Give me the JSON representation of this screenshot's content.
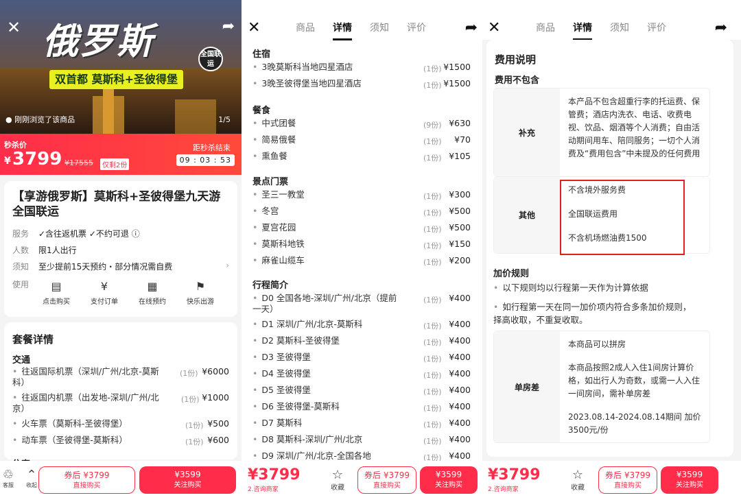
{
  "hero": {
    "title": "俄罗斯",
    "subtitle": "双首都 莫斯科+圣彼得堡",
    "badge": "全国联运",
    "viewed": "刚刚浏览了该商品",
    "count": "1/5"
  },
  "price": {
    "label": "秒杀价",
    "currency": "¥",
    "value": "3799",
    "original": "¥17555",
    "stock": "仅剩2份",
    "countdown_label": "距秒杀结束",
    "countdown": "09 : 03 : 53"
  },
  "product": {
    "title": "【享游俄罗斯】莫斯科+圣彼得堡九天游全国联运",
    "rows": [
      {
        "k": "服务",
        "v": "✓含往返机票  ✓不约可退 ⓘ"
      },
      {
        "k": "人数",
        "v": "限1人出行"
      },
      {
        "k": "须知",
        "v": "至少提前15天预约・部分情况需自费"
      },
      {
        "k": "使用",
        "v": ""
      }
    ],
    "steps": [
      "点击购买",
      "支付订单",
      "在线预约",
      "快乐出游"
    ]
  },
  "package": {
    "title": "套餐详情",
    "transport_title": "交通",
    "transport": [
      {
        "name": "往返国际机票（深圳/广州/北京-莫斯科）",
        "qty": "(1份)",
        "price": "¥6000"
      },
      {
        "name": "往返国内机票（出发地-深圳/广州/北京）",
        "qty": "(1份)",
        "price": "¥1000"
      },
      {
        "name": "火车票（莫斯科-圣彼得堡）",
        "qty": "(1份)",
        "price": "¥500"
      },
      {
        "name": "动车票（圣彼得堡-莫斯科）",
        "qty": "(1份)",
        "price": "¥600"
      }
    ],
    "next_title": "住宿"
  },
  "detail": {
    "tabs": [
      "商品",
      "详情",
      "须知",
      "评价"
    ],
    "lodging_title": "住宿",
    "lodging": [
      {
        "name": "3晚莫斯科当地四星酒店",
        "qty": "(1份)",
        "price": "¥1500"
      },
      {
        "name": "3晚圣彼得堡当地四星酒店",
        "qty": "(1份)",
        "price": "¥1500"
      }
    ],
    "meals_title": "餐食",
    "meals": [
      {
        "name": "中式团餐",
        "qty": "(9份)",
        "price": "¥630"
      },
      {
        "name": "简易俄餐",
        "qty": "(1份)",
        "price": "¥70"
      },
      {
        "name": "熏鱼餐",
        "qty": "(1份)",
        "price": "¥105"
      }
    ],
    "tickets_title": "景点门票",
    "tickets": [
      {
        "name": "圣三一教堂",
        "qty": "(1份)",
        "price": "¥300"
      },
      {
        "name": "冬宫",
        "qty": "(1份)",
        "price": "¥500"
      },
      {
        "name": "夏宫花园",
        "qty": "(1份)",
        "price": "¥500"
      },
      {
        "name": "莫斯科地铁",
        "qty": "(1份)",
        "price": "¥150"
      },
      {
        "name": "麻雀山缆车",
        "qty": "(1份)",
        "price": "¥200"
      }
    ],
    "itinerary_title": "行程简介",
    "itinerary": [
      {
        "name": "D0 全国各地-深圳/广州/北京（提前一天）",
        "qty": "(1份)",
        "price": "¥400"
      },
      {
        "name": "D1 深圳/广州/北京-莫斯科",
        "qty": "(1份)",
        "price": "¥400"
      },
      {
        "name": "D2 莫斯科-圣彼得堡",
        "qty": "(1份)",
        "price": "¥400"
      },
      {
        "name": "D3 圣彼得堡",
        "qty": "(1份)",
        "price": "¥400"
      },
      {
        "name": "D4 圣彼得堡",
        "qty": "(1份)",
        "price": "¥400"
      },
      {
        "name": "D5 圣彼得堡",
        "qty": "(1份)",
        "price": "¥400"
      },
      {
        "name": "D6 圣彼得堡-莫斯科",
        "qty": "(1份)",
        "price": "¥400"
      },
      {
        "name": "D7 莫斯科",
        "qty": "(1份)",
        "price": "¥400"
      },
      {
        "name": "D8 莫斯科-深圳/广州/北京",
        "qty": "(1份)",
        "price": "¥400"
      },
      {
        "name": "D9 深圳/广州/北京-全国各地",
        "qty": "(1份)",
        "price": "¥400"
      }
    ]
  },
  "fees": {
    "title": "费用说明",
    "excluded_title": "费用不包含",
    "supplement_label": "补充",
    "supplement_text": "本产品不包含超重行李的托运费、保管费；酒店内洗衣、电话、收费电视、饮品、烟酒等个人消费；自由活动期间用车、陪同服务；一切个人消费及“费用包含”中未提及的任何费用",
    "other_label": "其他",
    "other_items": [
      "不含境外服务费",
      "全国联运费用",
      "不含机场燃油费1500"
    ],
    "rules_title": "加价规则",
    "rules": [
      "以下规则均以行程第一天作为计算依据",
      "如行程第一天在同一加价项内符合多条加价规则，择高收取，不重复收取。"
    ],
    "single_label": "单房差",
    "single_items": [
      "本商品可以拼房",
      "本商品按照2成人入住1间房计算价格，如出行人为奇数，或需一人入住一间房间，需补单房差",
      "2023.08.14-2024.08.14期间 加价3500元/份"
    ]
  },
  "bottom": {
    "p1_icons": [
      "客服",
      "收起",
      "店铺"
    ],
    "coupon_label": "券后 ¥3799",
    "coupon_sub": "直接购买",
    "follow_price": "¥3599",
    "follow_sub": "关注购买",
    "big_price": "¥3799",
    "big_sub": "2.咨询商家",
    "fav_label": "收藏"
  },
  "colors": {
    "accent": "#ff2d4a",
    "highlight": "#e02020"
  }
}
